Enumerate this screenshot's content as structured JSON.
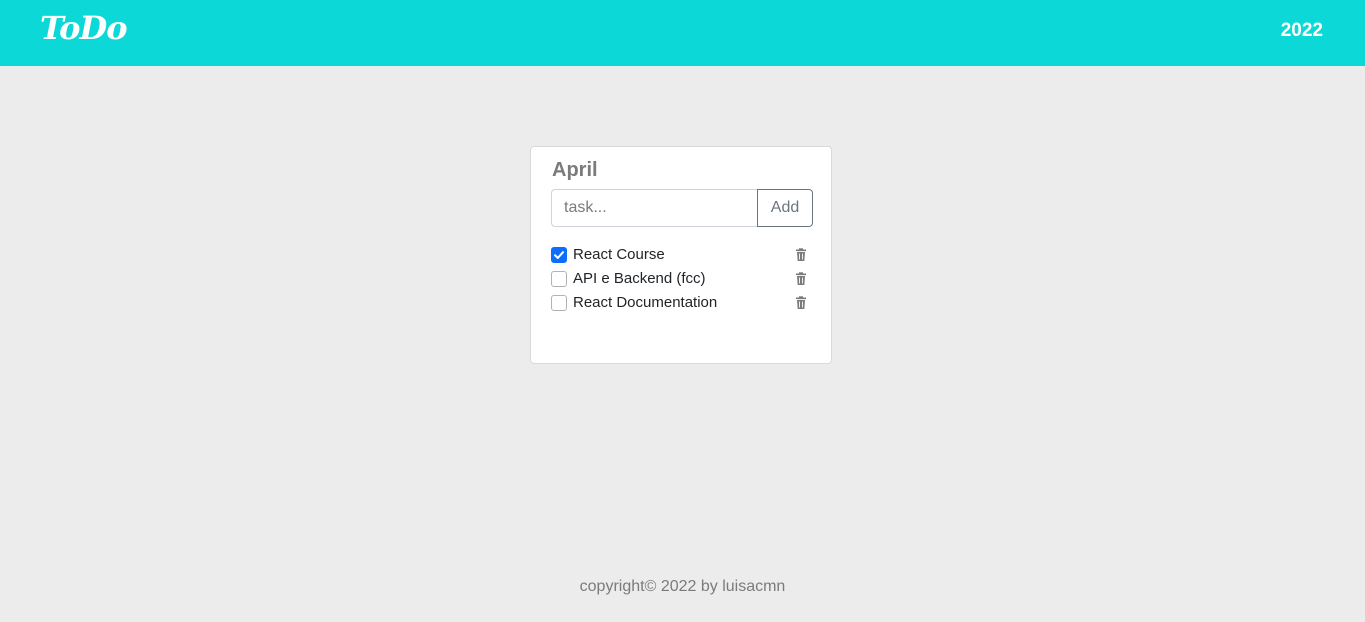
{
  "header": {
    "brand": "ToDo",
    "year": "2022",
    "background_color": "#0cd9d7"
  },
  "card": {
    "title": "April",
    "input": {
      "placeholder": "task...",
      "value": ""
    },
    "add_label": "Add",
    "tasks": [
      {
        "label": "React Course",
        "checked": true,
        "icon": "trash-icon"
      },
      {
        "label": "API e Backend (fcc)",
        "checked": false,
        "icon": "trash-icon"
      },
      {
        "label": "React Documentation",
        "checked": false,
        "icon": "trash-icon"
      }
    ]
  },
  "footer": {
    "text": "copyright© 2022 by luisacmn"
  },
  "colors": {
    "checkbox_checked": "#0d6efd",
    "page_background": "#ececec"
  }
}
